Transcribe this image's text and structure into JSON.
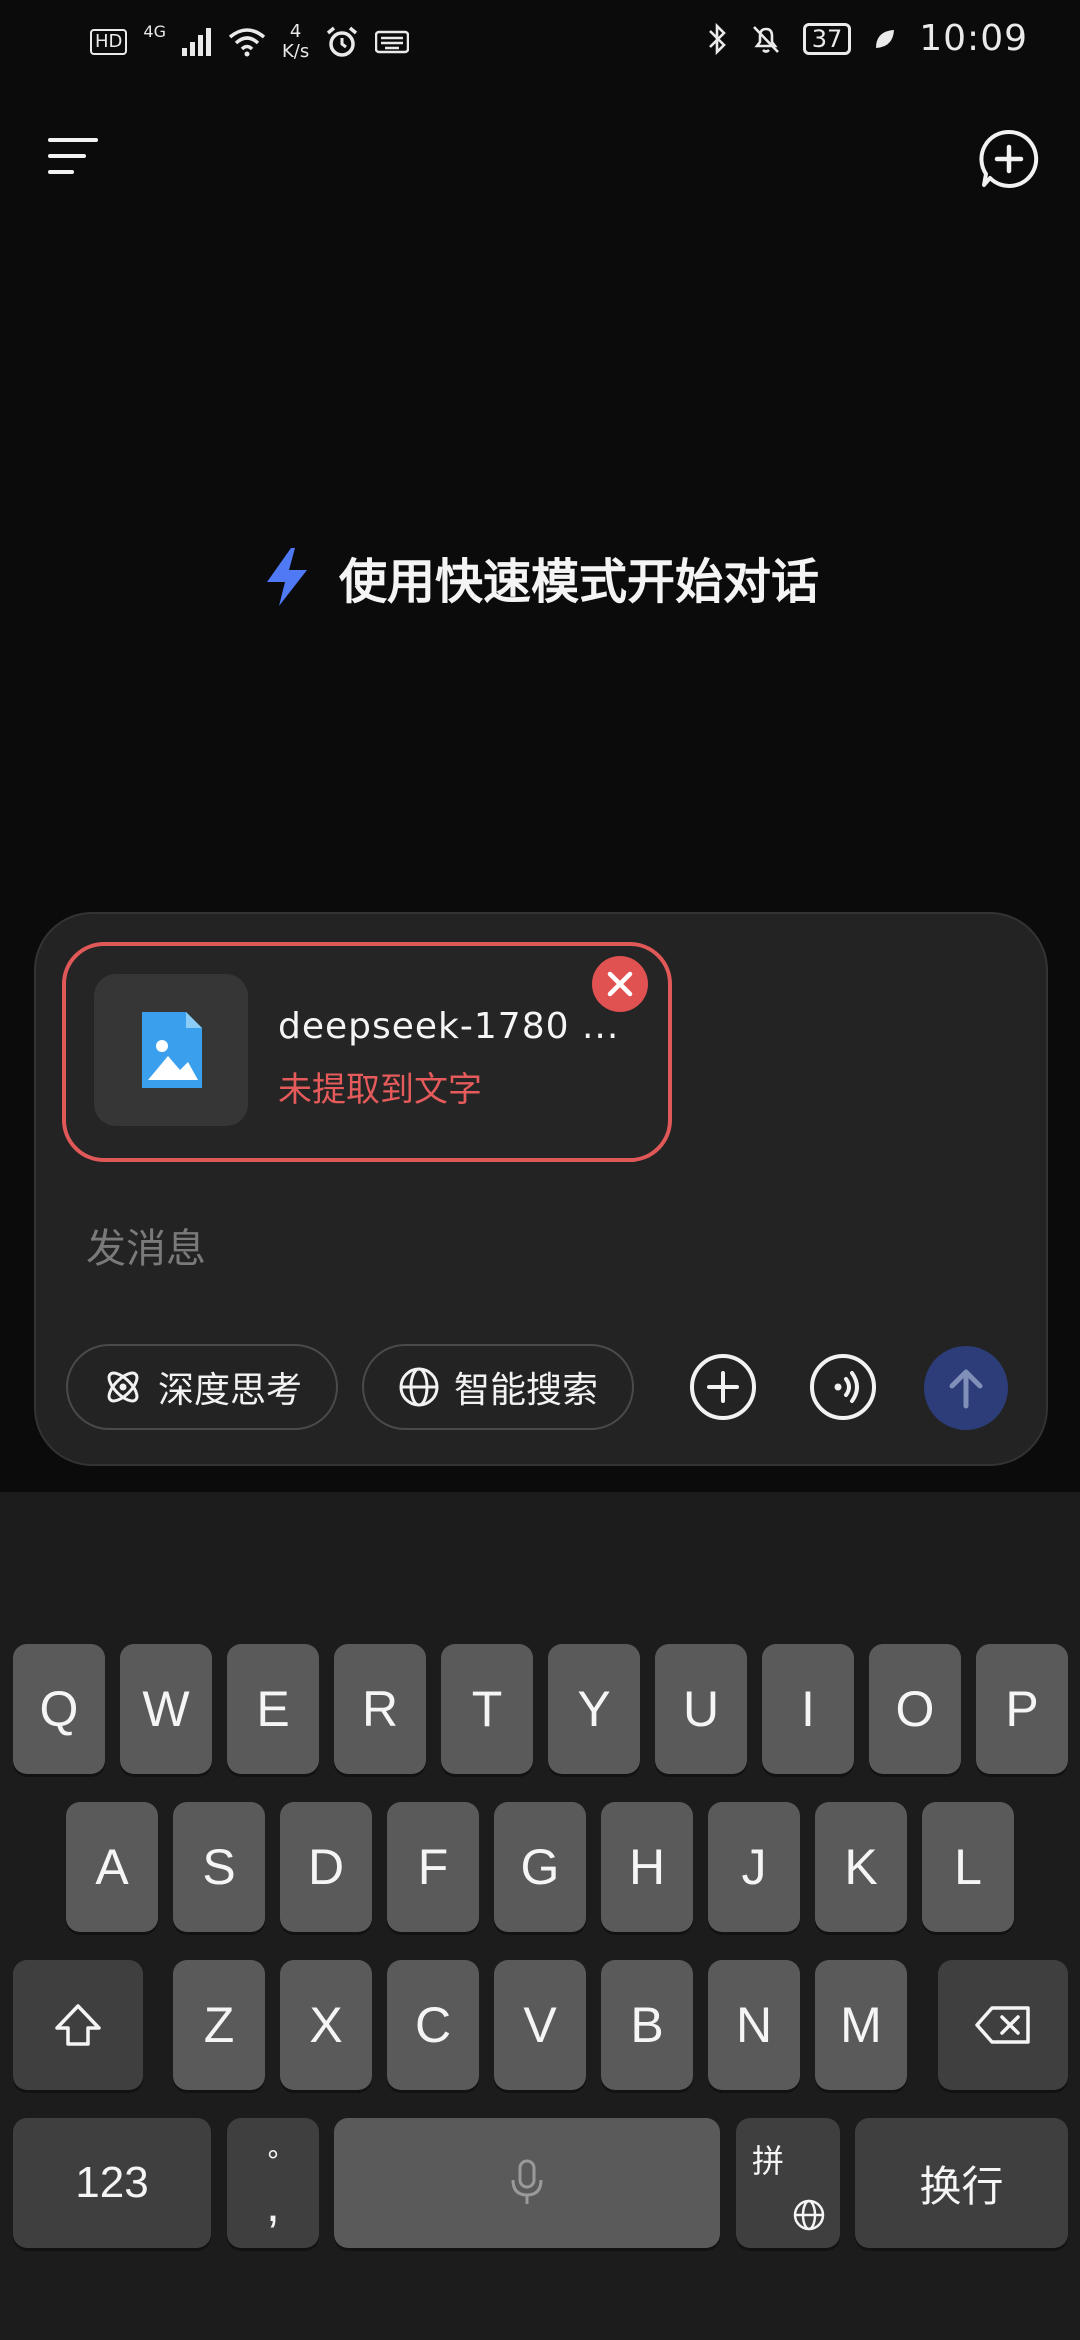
{
  "status_bar": {
    "hd": "HD",
    "network": "4G",
    "net_speed_value": "4",
    "net_speed_unit": "K/s",
    "battery": "37",
    "time": "10:09"
  },
  "empty_state": {
    "hint": "使用快速模式开始对话"
  },
  "composer": {
    "attachment": {
      "file_name": "deepseek-1780 ...",
      "status": "未提取到文字"
    },
    "placeholder": "发消息",
    "toggles": {
      "deep_think": "深度思考",
      "smart_search": "智能搜索"
    }
  },
  "keyboard": {
    "row1": [
      "Q",
      "W",
      "E",
      "R",
      "T",
      "Y",
      "U",
      "I",
      "O",
      "P"
    ],
    "row2": [
      "A",
      "S",
      "D",
      "F",
      "G",
      "H",
      "J",
      "K",
      "L"
    ],
    "row3": [
      "Z",
      "X",
      "C",
      "V",
      "B",
      "N",
      "M"
    ],
    "num_key": "123",
    "punct_top": "°",
    "punct_bottom": ",",
    "ime_key": "拼",
    "enter_key": "换行"
  },
  "colors": {
    "accent_blue": "#4f79f5",
    "error_red": "#e05858",
    "send_disabled": "#2c3d79"
  }
}
